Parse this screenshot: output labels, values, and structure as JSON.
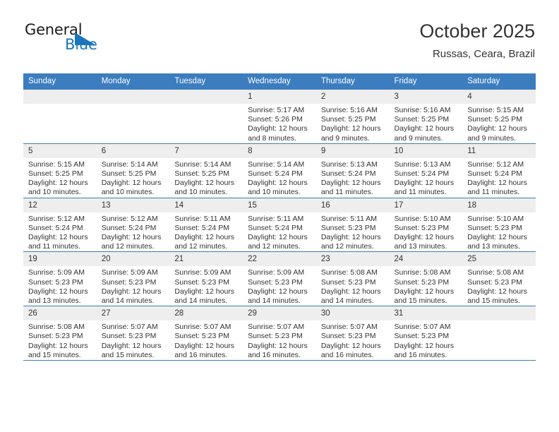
{
  "brand": {
    "line1": "General",
    "line2": "Blue",
    "triangle_color": "#1b75bb"
  },
  "header": {
    "title": "October 2025",
    "subtitle": "Russas, Ceara, Brazil"
  },
  "theme": {
    "header_blue": "#3c7dbf",
    "daynum_gray": "#eeeeee",
    "text": "#333333"
  },
  "weekday_headers": [
    "Sunday",
    "Monday",
    "Tuesday",
    "Wednesday",
    "Thursday",
    "Friday",
    "Saturday"
  ],
  "weeks": [
    [
      {
        "day": "",
        "empty": true
      },
      {
        "day": "",
        "empty": true
      },
      {
        "day": "",
        "empty": true
      },
      {
        "day": "1",
        "sunrise": "Sunrise: 5:17 AM",
        "sunset": "Sunset: 5:26 PM",
        "daylight": "Daylight: 12 hours and 8 minutes."
      },
      {
        "day": "2",
        "sunrise": "Sunrise: 5:16 AM",
        "sunset": "Sunset: 5:25 PM",
        "daylight": "Daylight: 12 hours and 9 minutes."
      },
      {
        "day": "3",
        "sunrise": "Sunrise: 5:16 AM",
        "sunset": "Sunset: 5:25 PM",
        "daylight": "Daylight: 12 hours and 9 minutes."
      },
      {
        "day": "4",
        "sunrise": "Sunrise: 5:15 AM",
        "sunset": "Sunset: 5:25 PM",
        "daylight": "Daylight: 12 hours and 9 minutes."
      }
    ],
    [
      {
        "day": "5",
        "sunrise": "Sunrise: 5:15 AM",
        "sunset": "Sunset: 5:25 PM",
        "daylight": "Daylight: 12 hours and 10 minutes."
      },
      {
        "day": "6",
        "sunrise": "Sunrise: 5:14 AM",
        "sunset": "Sunset: 5:25 PM",
        "daylight": "Daylight: 12 hours and 10 minutes."
      },
      {
        "day": "7",
        "sunrise": "Sunrise: 5:14 AM",
        "sunset": "Sunset: 5:25 PM",
        "daylight": "Daylight: 12 hours and 10 minutes."
      },
      {
        "day": "8",
        "sunrise": "Sunrise: 5:14 AM",
        "sunset": "Sunset: 5:24 PM",
        "daylight": "Daylight: 12 hours and 10 minutes."
      },
      {
        "day": "9",
        "sunrise": "Sunrise: 5:13 AM",
        "sunset": "Sunset: 5:24 PM",
        "daylight": "Daylight: 12 hours and 11 minutes."
      },
      {
        "day": "10",
        "sunrise": "Sunrise: 5:13 AM",
        "sunset": "Sunset: 5:24 PM",
        "daylight": "Daylight: 12 hours and 11 minutes."
      },
      {
        "day": "11",
        "sunrise": "Sunrise: 5:12 AM",
        "sunset": "Sunset: 5:24 PM",
        "daylight": "Daylight: 12 hours and 11 minutes."
      }
    ],
    [
      {
        "day": "12",
        "sunrise": "Sunrise: 5:12 AM",
        "sunset": "Sunset: 5:24 PM",
        "daylight": "Daylight: 12 hours and 11 minutes."
      },
      {
        "day": "13",
        "sunrise": "Sunrise: 5:12 AM",
        "sunset": "Sunset: 5:24 PM",
        "daylight": "Daylight: 12 hours and 12 minutes."
      },
      {
        "day": "14",
        "sunrise": "Sunrise: 5:11 AM",
        "sunset": "Sunset: 5:24 PM",
        "daylight": "Daylight: 12 hours and 12 minutes."
      },
      {
        "day": "15",
        "sunrise": "Sunrise: 5:11 AM",
        "sunset": "Sunset: 5:24 PM",
        "daylight": "Daylight: 12 hours and 12 minutes."
      },
      {
        "day": "16",
        "sunrise": "Sunrise: 5:11 AM",
        "sunset": "Sunset: 5:23 PM",
        "daylight": "Daylight: 12 hours and 12 minutes."
      },
      {
        "day": "17",
        "sunrise": "Sunrise: 5:10 AM",
        "sunset": "Sunset: 5:23 PM",
        "daylight": "Daylight: 12 hours and 13 minutes."
      },
      {
        "day": "18",
        "sunrise": "Sunrise: 5:10 AM",
        "sunset": "Sunset: 5:23 PM",
        "daylight": "Daylight: 12 hours and 13 minutes."
      }
    ],
    [
      {
        "day": "19",
        "sunrise": "Sunrise: 5:09 AM",
        "sunset": "Sunset: 5:23 PM",
        "daylight": "Daylight: 12 hours and 13 minutes."
      },
      {
        "day": "20",
        "sunrise": "Sunrise: 5:09 AM",
        "sunset": "Sunset: 5:23 PM",
        "daylight": "Daylight: 12 hours and 14 minutes."
      },
      {
        "day": "21",
        "sunrise": "Sunrise: 5:09 AM",
        "sunset": "Sunset: 5:23 PM",
        "daylight": "Daylight: 12 hours and 14 minutes."
      },
      {
        "day": "22",
        "sunrise": "Sunrise: 5:09 AM",
        "sunset": "Sunset: 5:23 PM",
        "daylight": "Daylight: 12 hours and 14 minutes."
      },
      {
        "day": "23",
        "sunrise": "Sunrise: 5:08 AM",
        "sunset": "Sunset: 5:23 PM",
        "daylight": "Daylight: 12 hours and 14 minutes."
      },
      {
        "day": "24",
        "sunrise": "Sunrise: 5:08 AM",
        "sunset": "Sunset: 5:23 PM",
        "daylight": "Daylight: 12 hours and 15 minutes."
      },
      {
        "day": "25",
        "sunrise": "Sunrise: 5:08 AM",
        "sunset": "Sunset: 5:23 PM",
        "daylight": "Daylight: 12 hours and 15 minutes."
      }
    ],
    [
      {
        "day": "26",
        "sunrise": "Sunrise: 5:08 AM",
        "sunset": "Sunset: 5:23 PM",
        "daylight": "Daylight: 12 hours and 15 minutes."
      },
      {
        "day": "27",
        "sunrise": "Sunrise: 5:07 AM",
        "sunset": "Sunset: 5:23 PM",
        "daylight": "Daylight: 12 hours and 15 minutes."
      },
      {
        "day": "28",
        "sunrise": "Sunrise: 5:07 AM",
        "sunset": "Sunset: 5:23 PM",
        "daylight": "Daylight: 12 hours and 16 minutes."
      },
      {
        "day": "29",
        "sunrise": "Sunrise: 5:07 AM",
        "sunset": "Sunset: 5:23 PM",
        "daylight": "Daylight: 12 hours and 16 minutes."
      },
      {
        "day": "30",
        "sunrise": "Sunrise: 5:07 AM",
        "sunset": "Sunset: 5:23 PM",
        "daylight": "Daylight: 12 hours and 16 minutes."
      },
      {
        "day": "31",
        "sunrise": "Sunrise: 5:07 AM",
        "sunset": "Sunset: 5:23 PM",
        "daylight": "Daylight: 12 hours and 16 minutes."
      },
      {
        "day": "",
        "empty": true
      }
    ]
  ]
}
